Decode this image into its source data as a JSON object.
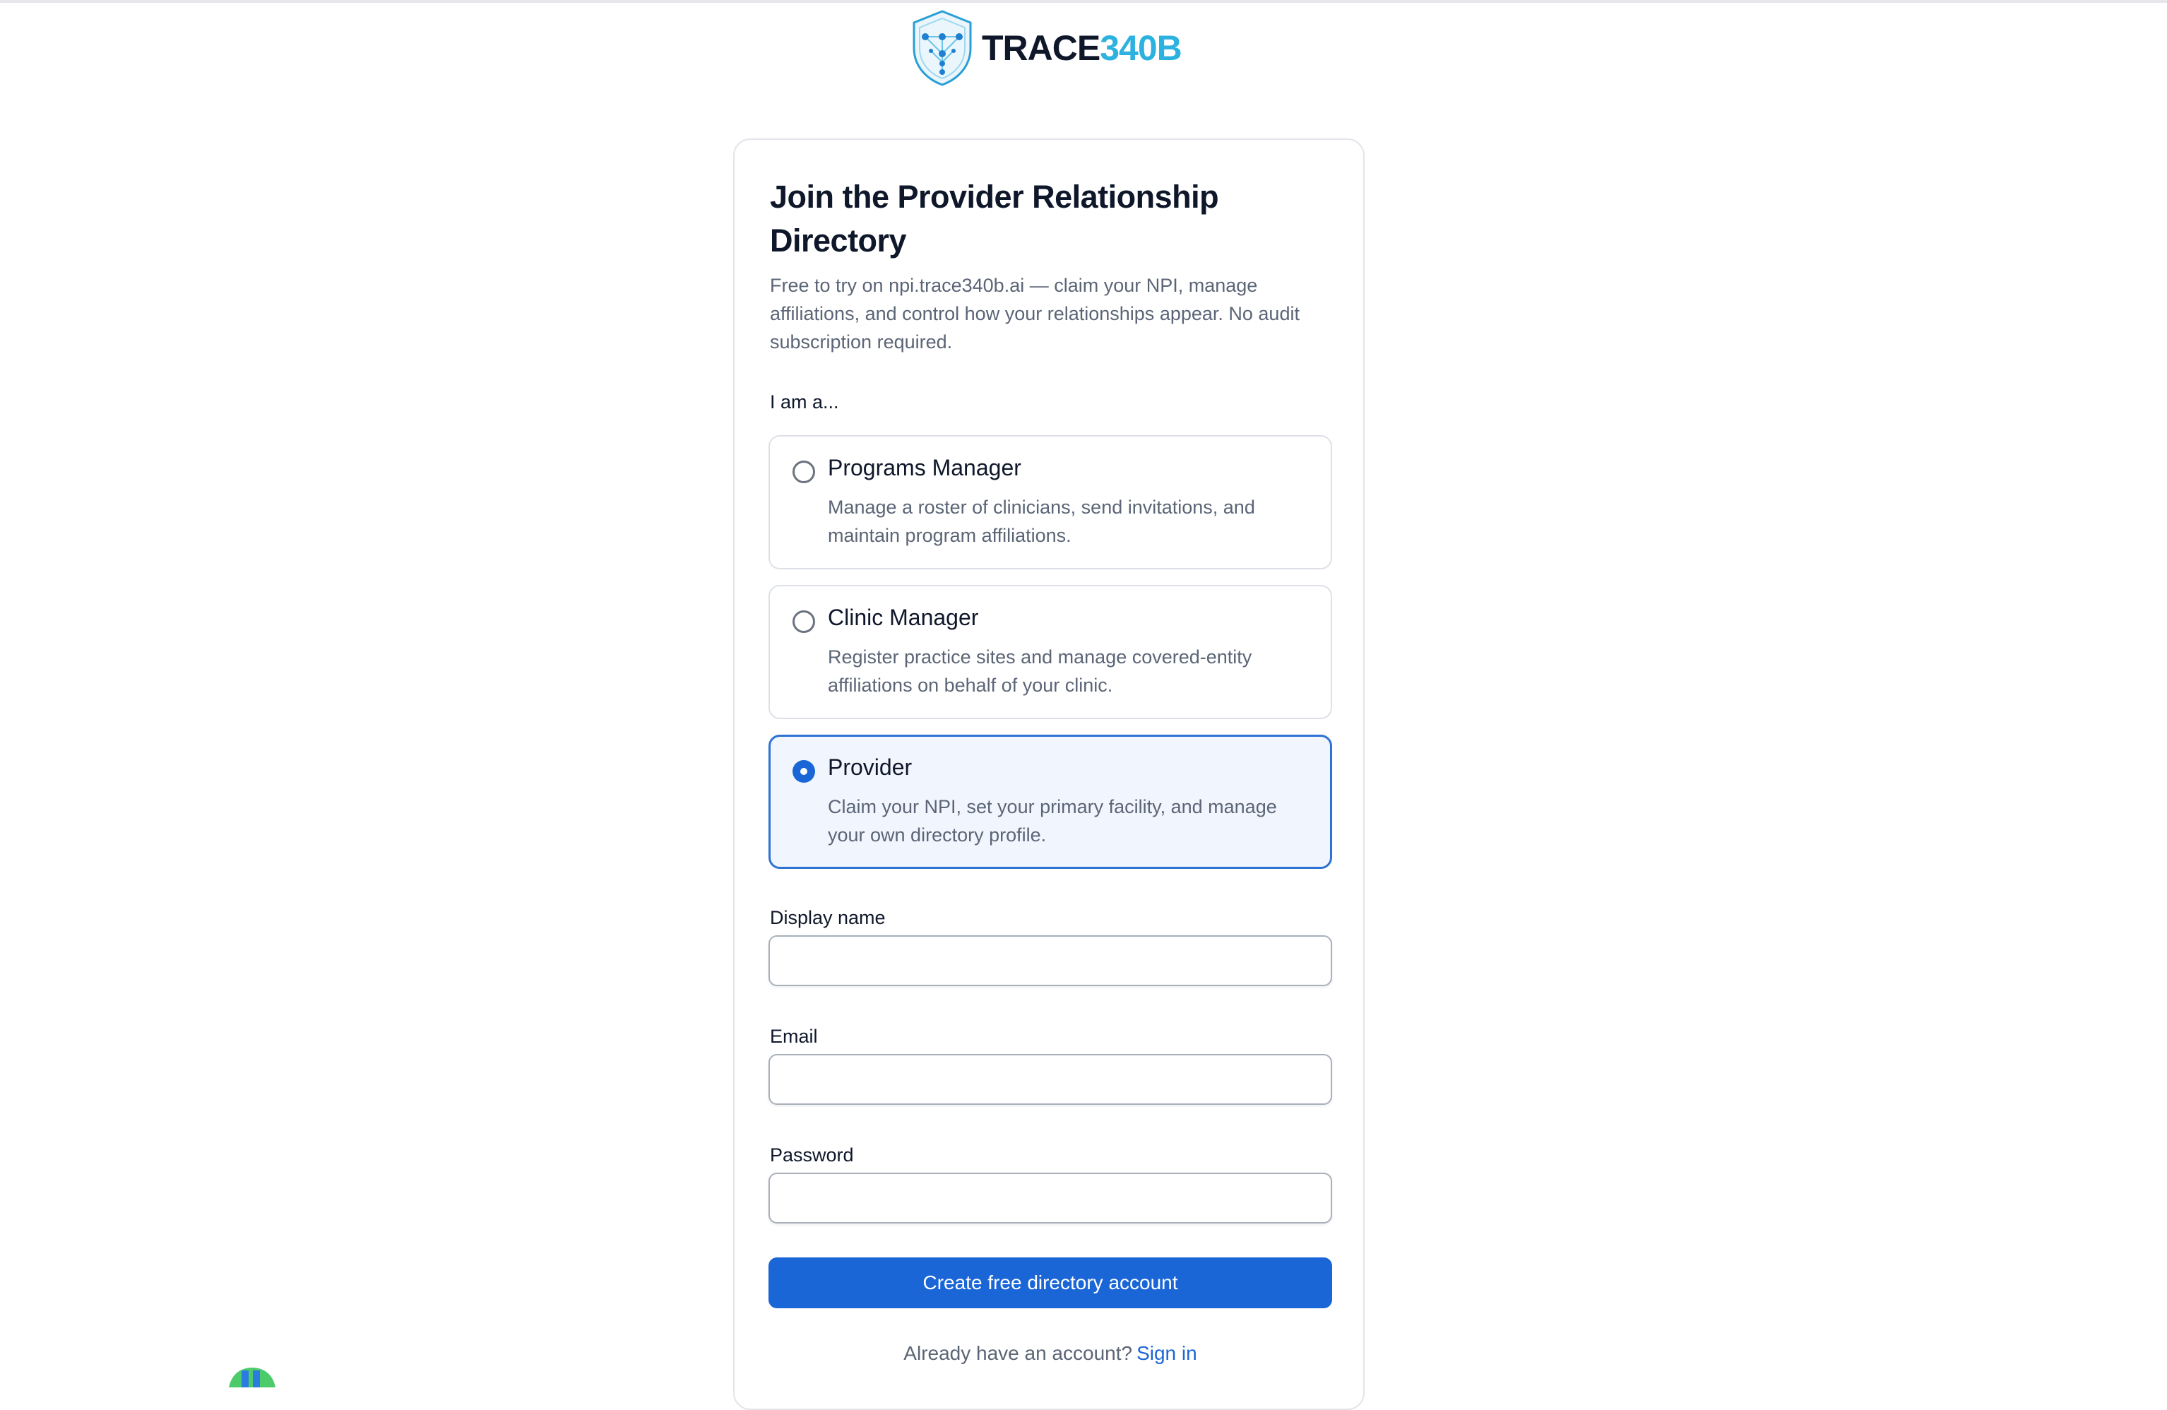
{
  "brand": {
    "name_part1": "TRACE",
    "name_part2": "340B",
    "logo_icon": "shield-network-icon",
    "colors": {
      "dark": "#0f172a",
      "accent": "#2db2e0"
    }
  },
  "form": {
    "title": "Join the Provider Relationship Directory",
    "subtitle": "Free to try on npi.trace340b.ai — claim your NPI, manage affiliations, and control how your relationships appear. No audit subscription required.",
    "role_prompt": "I am a...",
    "roles": [
      {
        "title": "Programs Manager",
        "description": "Manage a roster of clinicians, send invitations, and maintain program affiliations.",
        "selected": false
      },
      {
        "title": "Clinic Manager",
        "description": "Register practice sites and manage covered-entity affiliations on behalf of your clinic.",
        "selected": false
      },
      {
        "title": "Provider",
        "description": "Claim your NPI, set your primary facility, and manage your own directory profile.",
        "selected": true
      }
    ],
    "fields": {
      "display_name": {
        "label": "Display name",
        "value": "",
        "placeholder": ""
      },
      "email": {
        "label": "Email",
        "value": "",
        "placeholder": ""
      },
      "password": {
        "label": "Password",
        "value": "",
        "placeholder": ""
      }
    },
    "submit_label": "Create free directory account",
    "signin_prompt": "Already have an account?",
    "signin_link": "Sign in"
  },
  "colors": {
    "primary": "#1a66d6",
    "selected_bg": "#f1f6fe",
    "border": "#dde1e7",
    "muted_text": "#5b6576"
  }
}
